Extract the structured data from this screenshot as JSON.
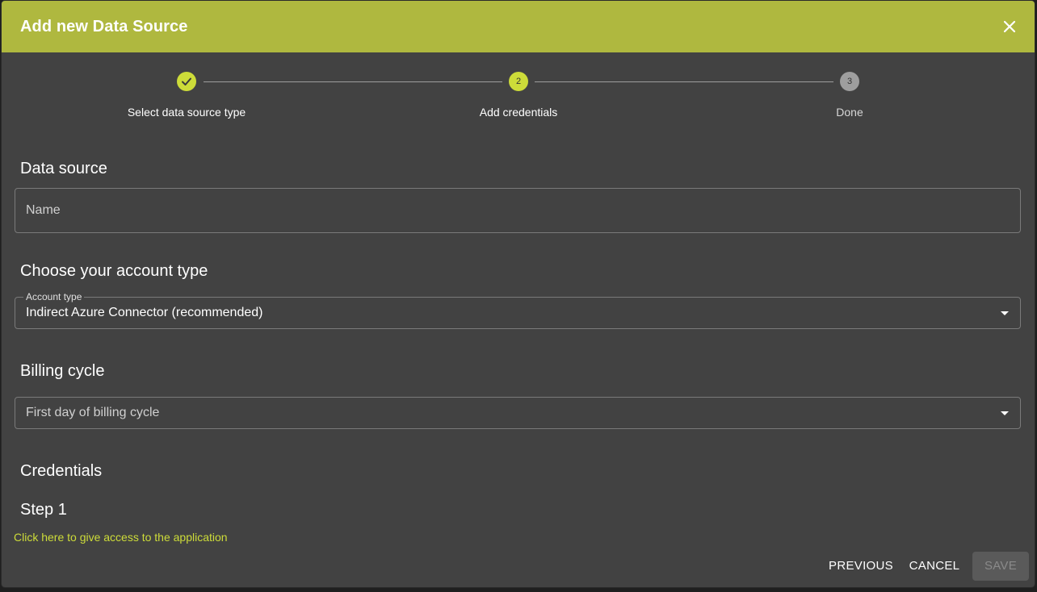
{
  "dialog": {
    "title": "Add new Data Source",
    "close_icon": "close-icon"
  },
  "stepper": {
    "steps": [
      {
        "label": "Select data source type",
        "number": "",
        "state": "completed"
      },
      {
        "label": "Add credentials",
        "number": "2",
        "state": "active"
      },
      {
        "label": "Done",
        "number": "3",
        "state": "pending"
      }
    ]
  },
  "data_source": {
    "title": "Data source",
    "name_placeholder": "Name"
  },
  "account": {
    "title": "Choose your account type",
    "field_label": "Account type",
    "selected": "Indirect Azure Connector (recommended)"
  },
  "billing": {
    "title": "Billing cycle",
    "placeholder": "First day of billing cycle"
  },
  "credentials": {
    "title": "Credentials",
    "step_title": "Step 1",
    "link": "Click here to give access to the application"
  },
  "actions": {
    "previous": "PREVIOUS",
    "cancel": "CANCEL",
    "save": "SAVE"
  },
  "colors": {
    "header": "#afb83f",
    "accent": "#cddc39",
    "background": "#424242",
    "pending_step": "#9e9e9e"
  }
}
